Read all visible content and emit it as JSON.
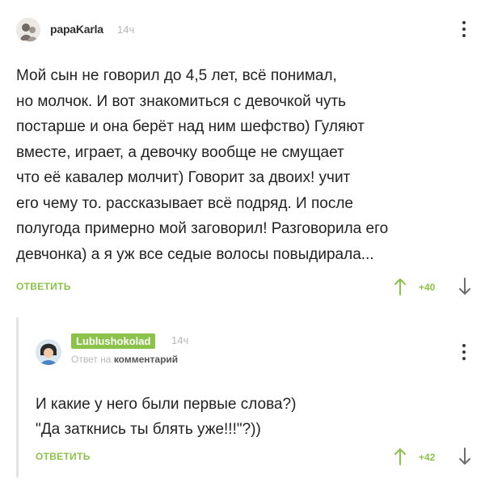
{
  "colors": {
    "accent": "#8bc34a",
    "muted": "#b7b7b7",
    "text": "#222222",
    "thread_line": "#e4e4e4"
  },
  "main_comment": {
    "username": "papaKarla",
    "time": "14ч",
    "lines": [
      "Мой сын не говорил до 4,5 лет, всё понимал,",
      "но молчок. И вот знакомиться с девочкой чуть",
      "постарше и она берёт над ним шефство) Гуляют",
      "вместе, играет, а девочку вообще не смущает",
      "что её кавалер молчит) Говорит за двоих! учит",
      "его чему то. рассказывает всё подряд. И после",
      "полугода примерно мой заговорил! Разговорила его",
      "девчонка) а я уж все седые волосы повыдирала..."
    ],
    "reply_label": "ОТВЕТИТЬ",
    "votes": "+40",
    "icons": {
      "avatar": "avatar-image",
      "menu": "kebab-menu-icon",
      "upvote": "arrow-up-icon",
      "downvote": "arrow-down-icon"
    }
  },
  "reply_comment": {
    "username": "Lublushokolad",
    "time": "14ч",
    "reply_prefix": "Ответ на",
    "reply_target": "комментарий",
    "lines": [
      "И какие у него были первые слова?)",
      "\"Да заткнись ты блять уже!!!\"?))"
    ],
    "reply_label": "ОТВЕТИТЬ",
    "votes": "+42"
  }
}
